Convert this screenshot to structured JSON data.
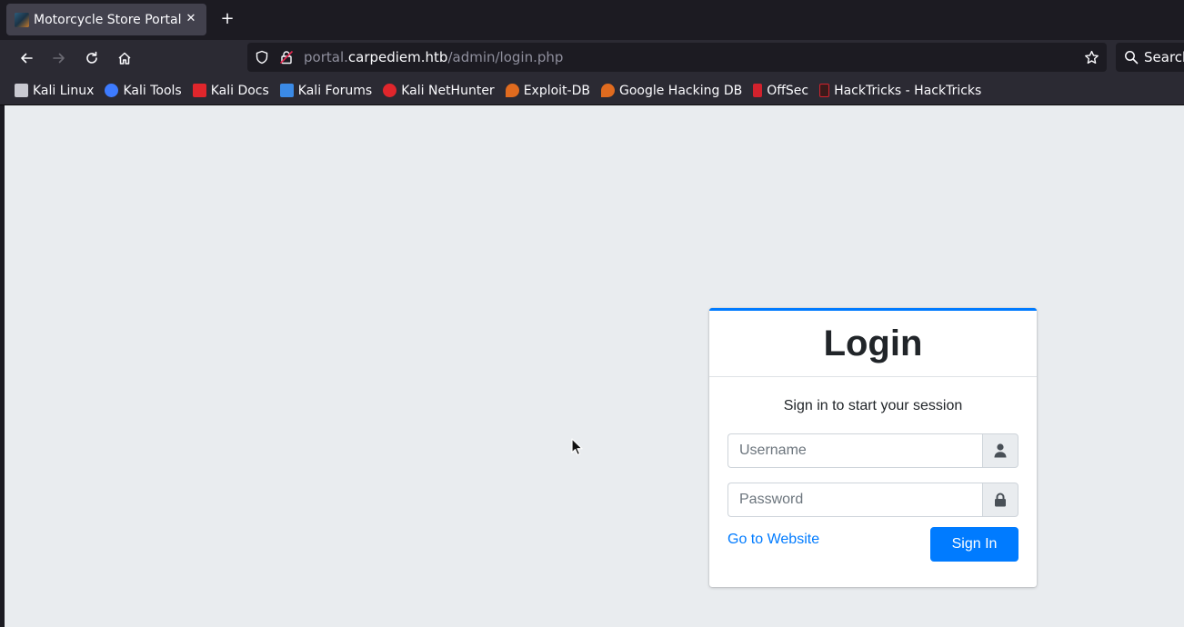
{
  "browser": {
    "tab": {
      "title": "Motorcycle Store Portal",
      "close": "✕"
    },
    "new_tab": "+",
    "url": {
      "prefix": "portal.",
      "host": "carpediem.htb",
      "path": "/admin/login.php"
    },
    "search_label": "Search",
    "bookmarks": [
      {
        "label": "Kali Linux",
        "icon": "kali-dragon-icon",
        "color": "#c9c9d1"
      },
      {
        "label": "Kali Tools",
        "icon": "kali-tools-icon",
        "color": "#3d7bff"
      },
      {
        "label": "Kali Docs",
        "icon": "kali-docs-icon",
        "color": "#e0262c"
      },
      {
        "label": "Kali Forums",
        "icon": "kali-forums-icon",
        "color": "#3b8ae6"
      },
      {
        "label": "Kali NetHunter",
        "icon": "nethunter-icon",
        "color": "#e0262c"
      },
      {
        "label": "Exploit-DB",
        "icon": "exploitdb-icon",
        "color": "#e06b1f"
      },
      {
        "label": "Google Hacking DB",
        "icon": "ghdb-icon",
        "color": "#e06b1f"
      },
      {
        "label": "OffSec",
        "icon": "offsec-icon",
        "color": "#d2222d"
      },
      {
        "label": "HackTricks - HackTricks",
        "icon": "hacktricks-icon",
        "color": "#d2222d"
      }
    ]
  },
  "login": {
    "title": "Login",
    "message": "Sign in to start your session",
    "username_placeholder": "Username",
    "password_placeholder": "Password",
    "goto_label": "Go to Website",
    "signin_label": "Sign In"
  },
  "colors": {
    "accent": "#007bff",
    "page_bg": "#e9ecef"
  }
}
